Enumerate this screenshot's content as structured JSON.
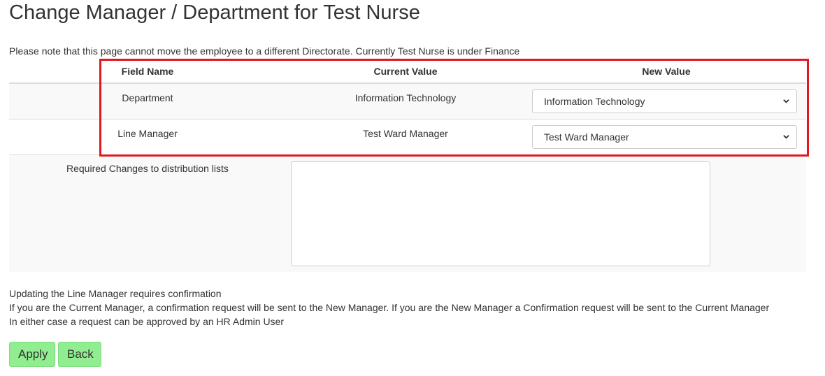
{
  "page": {
    "title": "Change Manager / Department for Test Nurse",
    "note": "Please note that this page cannot move the employee to a different Directorate. Currently Test Nurse is under Finance"
  },
  "table": {
    "headers": {
      "field_name": "Field Name",
      "current_value": "Current Value",
      "new_value": "New Value"
    },
    "rows": [
      {
        "field": "Department",
        "current": "Information Technology",
        "new_selected": "Information Technology"
      },
      {
        "field": "Line Manager",
        "current": "Test Ward Manager",
        "new_selected": "Test Ward Manager"
      }
    ]
  },
  "distribution": {
    "label": "Required Changes to distribution lists",
    "value": ""
  },
  "info": {
    "line1": "Updating the Line Manager requires confirmation",
    "line2": "If you are the Current Manager, a confirmation request will be sent to the New Manager. If you are the New Manager a Confirmation request will be sent to the Current Manager",
    "line3": "In either case a request can be approved by an HR Admin User"
  },
  "buttons": {
    "apply": "Apply",
    "back": "Back"
  },
  "colors": {
    "button_bg": "#90ee90",
    "highlight": "#e0191e",
    "stripe": "#f9f9f9"
  },
  "icons": {
    "select_arrow": "chevron-down-icon"
  }
}
